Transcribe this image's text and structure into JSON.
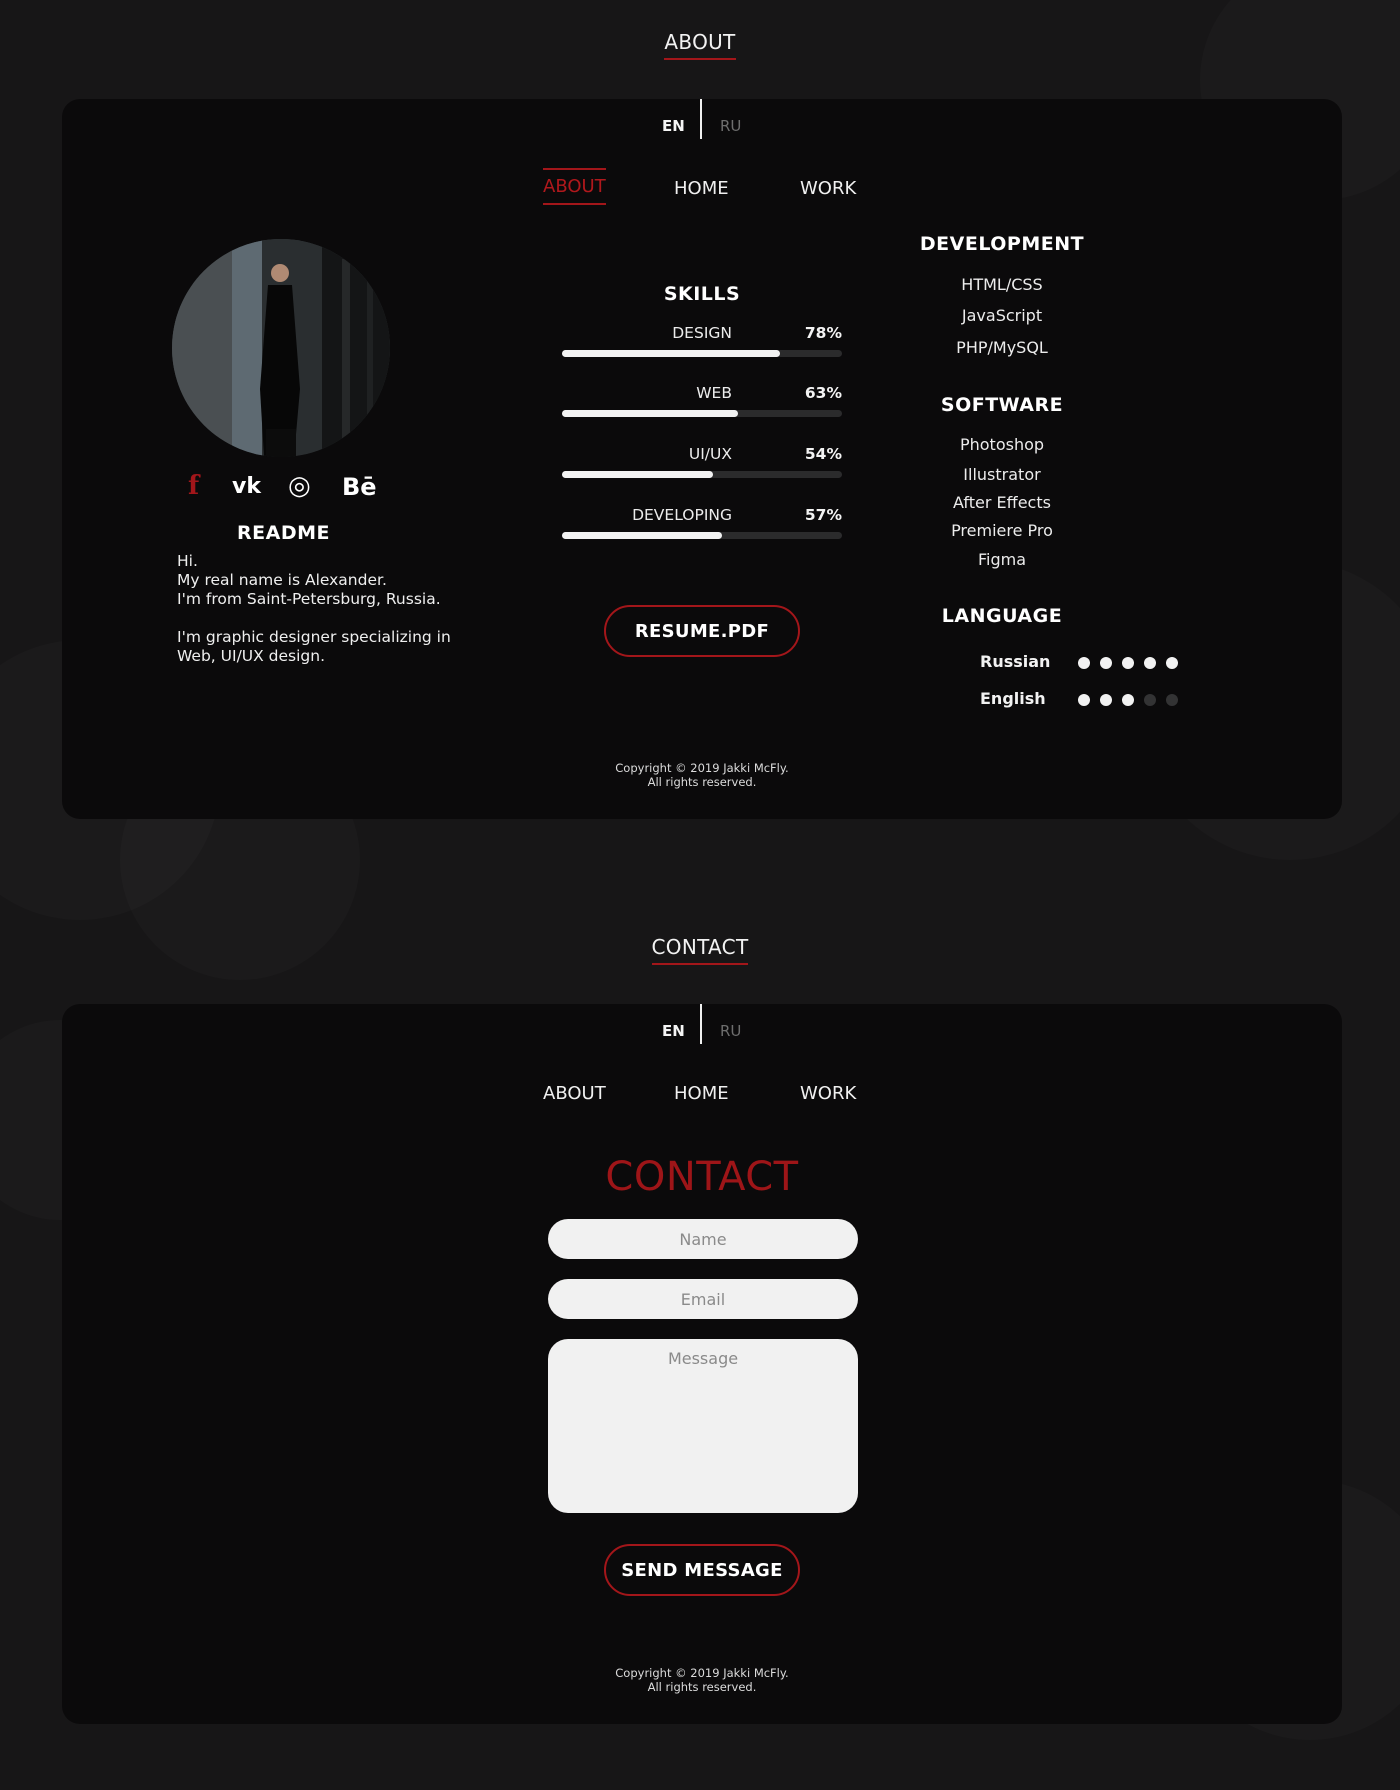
{
  "colors": {
    "accent": "#a3161a",
    "background": "#171617",
    "panel": "#0b0a0b"
  },
  "about_section": {
    "title": "ABOUT",
    "lang": {
      "en": "EN",
      "ru": "RU"
    },
    "nav": {
      "about": "ABOUT",
      "home": "HOME",
      "work": "WORK",
      "active": "about"
    },
    "socials": {
      "facebook": "f",
      "vk": "vk",
      "instagram": "◎",
      "behance": "Bē"
    },
    "readme": {
      "title": "README",
      "lines": [
        "Hi.",
        "My real name is Alexander.",
        "I'm from Saint-Petersburg, Russia.",
        "I'm graphic designer specializing in",
        "Web, UI/UX design."
      ]
    },
    "skills": {
      "title": "SKILLS",
      "items": [
        {
          "label": "DESIGN",
          "pct_text": "78%",
          "value": 0.78
        },
        {
          "label": "WEB",
          "pct_text": "63%",
          "value": 0.63
        },
        {
          "label": "UI/UX",
          "pct_text": "54%",
          "value": 0.54
        },
        {
          "label": "DEVELOPING",
          "pct_text": "57%",
          "value": 0.57
        }
      ]
    },
    "resume_button": "RESUME.PDF",
    "development": {
      "title": "DEVELOPMENT",
      "items": [
        "HTML/CSS",
        "JavaScript",
        "PHP/MySQL"
      ]
    },
    "software": {
      "title": "SOFTWARE",
      "items": [
        "Photoshop",
        "Illustrator",
        "After Effects",
        "Premiere Pro",
        "Figma"
      ]
    },
    "language": {
      "title": "LANGUAGE",
      "items": [
        {
          "name": "Russian",
          "level": 5,
          "max": 5
        },
        {
          "name": "English",
          "level": 3,
          "max": 5
        }
      ]
    },
    "copyright": {
      "line1": "Copyright © 2019 Jakki McFly.",
      "line2": "All rights reserved."
    }
  },
  "contact_section": {
    "title": "CONTACT",
    "lang": {
      "en": "EN",
      "ru": "RU"
    },
    "nav": {
      "about": "ABOUT",
      "home": "HOME",
      "work": "WORK"
    },
    "heading": "CONTACT",
    "form": {
      "name_placeholder": "Name",
      "email_placeholder": "Email",
      "message_placeholder": "Message",
      "submit": "SEND MESSAGE"
    },
    "copyright": {
      "line1": "Copyright © 2019 Jakki McFly.",
      "line2": "All rights reserved."
    }
  }
}
